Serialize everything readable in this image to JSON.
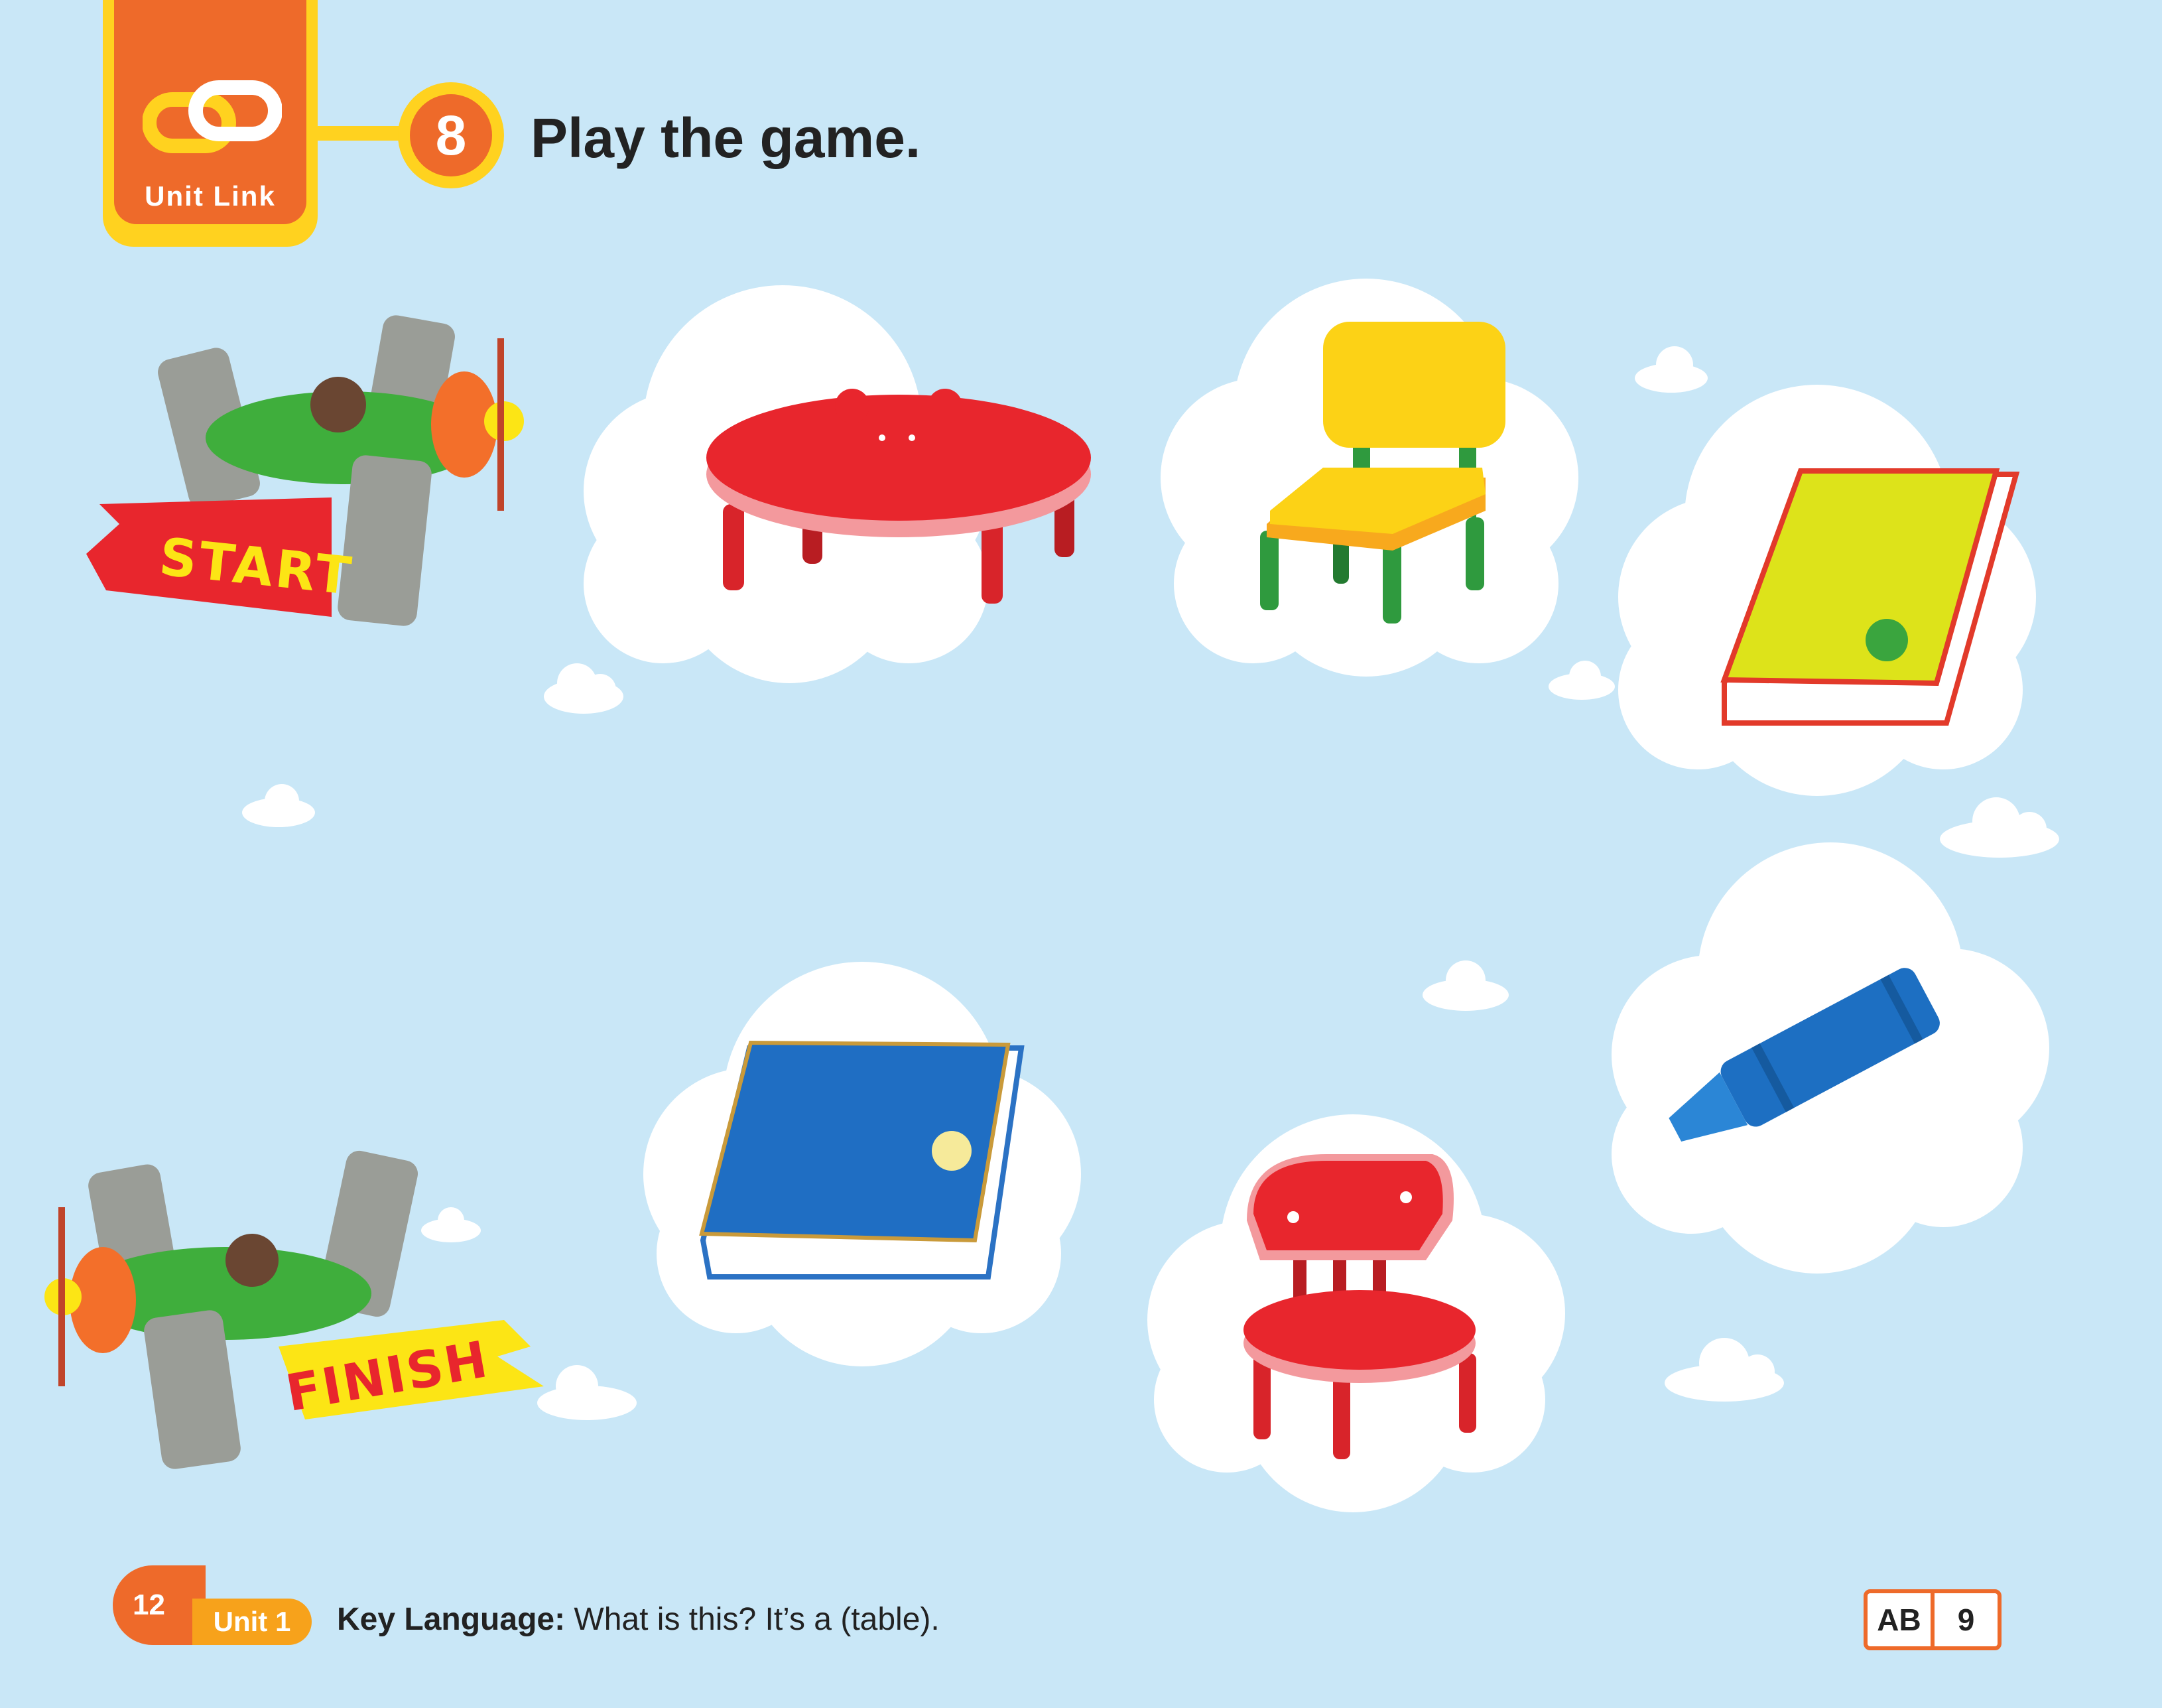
{
  "header": {
    "unit_link_label": "Unit Link",
    "activity_number": "8",
    "instruction": "Play the game."
  },
  "game": {
    "start_label": "START",
    "finish_label": "FINISH",
    "items": [
      "table",
      "chair",
      "book",
      "crayon",
      "chair",
      "book"
    ]
  },
  "footer": {
    "page_number": "12",
    "unit_label": "Unit 1",
    "key_language_label": "Key Language:",
    "key_language_text": "What is this? It’s a (table).",
    "ab_label": "AB",
    "ab_page": "9"
  },
  "colors": {
    "sky": "#c9e7f7",
    "accent_orange": "#ee6a2a",
    "accent_yellow": "#ffd21f"
  }
}
